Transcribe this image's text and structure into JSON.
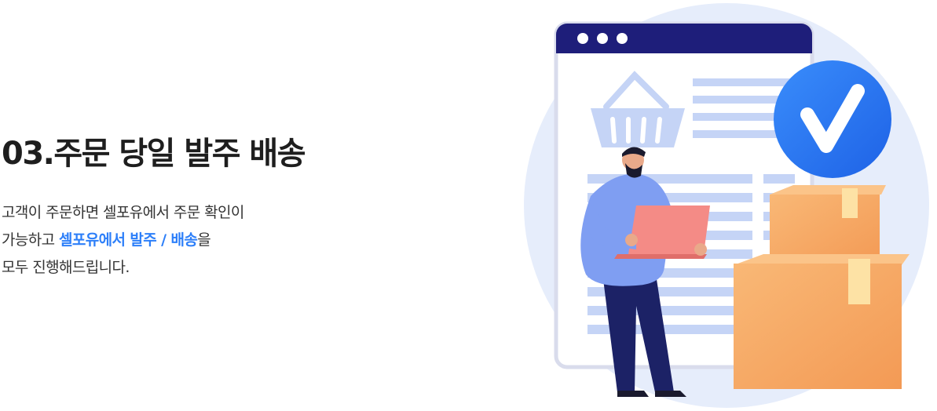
{
  "section": {
    "title": "03.주문 당일 발주 배송",
    "description": {
      "line1": "고객이 주문하면 셀포유에서 주문 확인이",
      "line2_prefix": "가능하고 ",
      "line2_highlight": "셀포유에서 발주 / 배송",
      "line2_suffix": "을",
      "line3": "모두 진행해드립니다."
    }
  },
  "colors": {
    "highlight": "#2d7ff9",
    "title": "#1e1e1e",
    "window_bar": "#1e1e7a",
    "check_badge": "#2d7ff9",
    "box": "#f7a862"
  },
  "icons": [
    "shopping-basket-icon",
    "checkmark-icon",
    "window-dots-icon"
  ]
}
